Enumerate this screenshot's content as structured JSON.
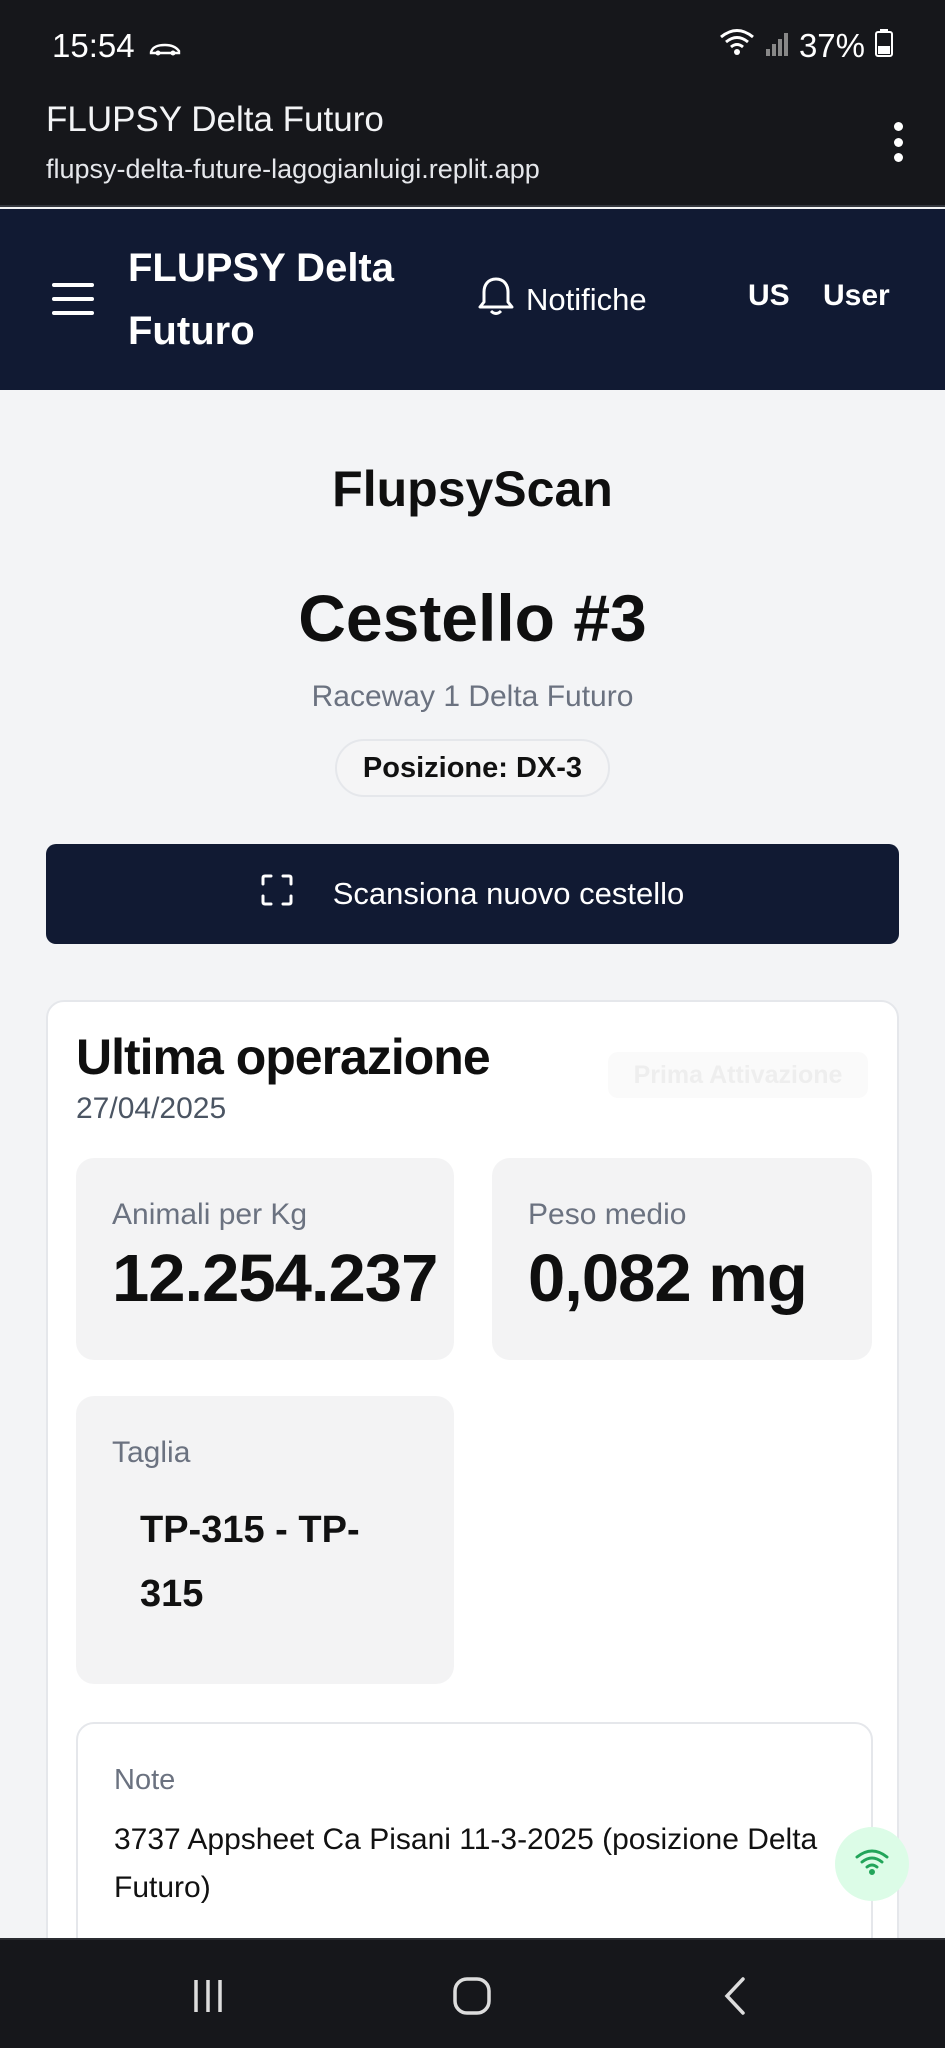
{
  "status_bar": {
    "time": "15:54",
    "battery": "37%",
    "icons": [
      "car-icon",
      "wifi-icon",
      "signal-icon",
      "battery-icon"
    ]
  },
  "browser": {
    "title": "FLUPSY Delta Futuro",
    "url": "flupsy-delta-future-lagogianluigi.replit.app",
    "menu_icon": "more-vert-icon"
  },
  "header": {
    "menu_icon": "hamburger-icon",
    "title": "FLUPSY Delta Futuro",
    "notifications_label": "Notifiche",
    "notifications_icon": "bell-icon",
    "avatar_initials": "US",
    "user_label": "User",
    "background": "#111a33"
  },
  "scan": {
    "page_title": "FlupsyScan",
    "basket_title": "Cestello #3",
    "raceway": "Raceway 1 Delta Futuro",
    "position": "Posizione: DX-3",
    "scan_button_label": "Scansiona nuovo cestello",
    "scan_icon": "scan-frame-icon"
  },
  "last_operation": {
    "title": "Ultima operazione",
    "date": "27/04/2025",
    "type_badge": "Prima Attivazione",
    "animals_per_kg_label": "Animali per Kg",
    "animals_per_kg_value": "12.254.237",
    "avg_weight_label": "Peso medio",
    "avg_weight_value": "0,082 mg",
    "size_label": "Taglia",
    "size_value": "TP-315 - TP-315",
    "notes_label": "Note",
    "notes_text": "3737 Appsheet Ca Pisani 11-3-2025 (posizione Delta Futuro)"
  },
  "connection_indicator": {
    "icon": "wifi-icon",
    "color": "#22a55a"
  },
  "nav_bar": {
    "icons": [
      "recents-icon",
      "home-icon",
      "back-icon"
    ]
  }
}
